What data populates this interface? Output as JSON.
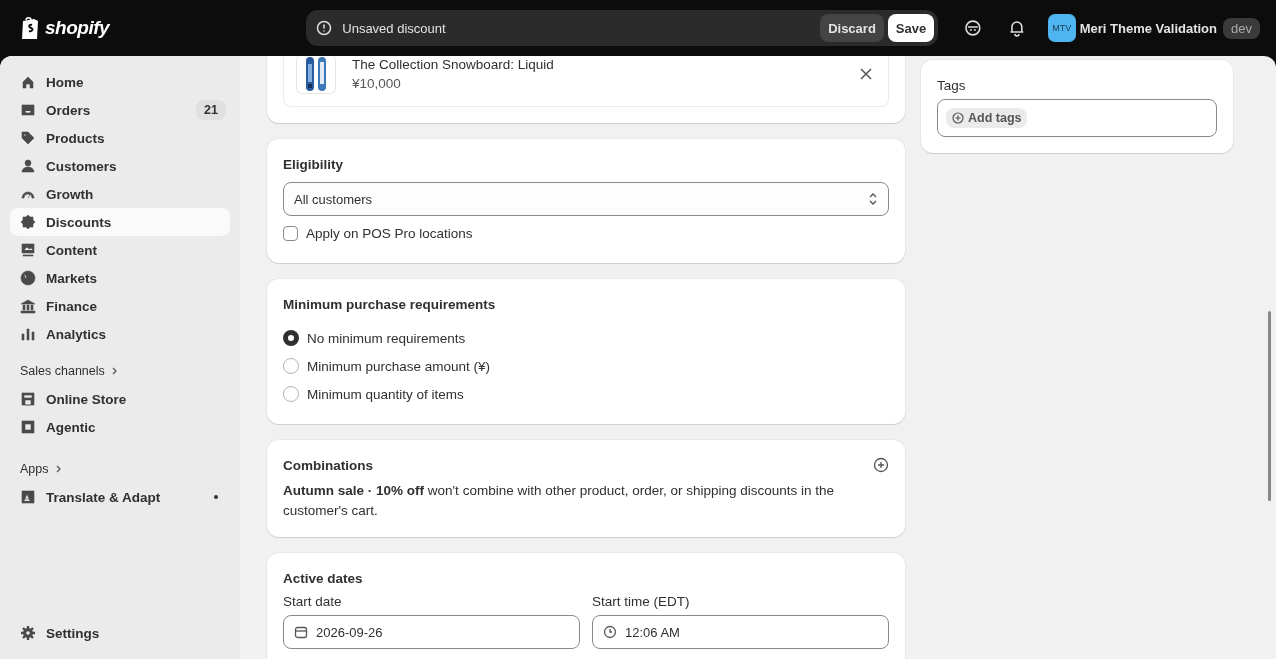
{
  "topbar": {
    "brand": "shopify",
    "notice": "Unsaved discount",
    "buttons": [
      {
        "label": "Discard",
        "kind": "secondary"
      },
      {
        "label": "Save",
        "kind": "primary"
      }
    ],
    "store": {
      "initials": "MTV",
      "name": "Meri Theme Validation",
      "badge": "dev"
    }
  },
  "sidebar": {
    "items": [
      {
        "label": "Home",
        "selected": false
      },
      {
        "label": "Orders",
        "selected": false,
        "count": "21"
      },
      {
        "label": "Products",
        "selected": false
      },
      {
        "label": "Customers",
        "selected": false
      },
      {
        "label": "Growth",
        "selected": false
      },
      {
        "label": "Discounts",
        "selected": true
      },
      {
        "label": "Content",
        "selected": false
      },
      {
        "label": "Markets",
        "selected": false
      },
      {
        "label": "Finance",
        "selected": false
      },
      {
        "label": "Analytics",
        "selected": false
      }
    ],
    "sections": [
      {
        "title": "Sales channels",
        "items": [
          {
            "label": "Online Store",
            "dot": false
          },
          {
            "label": "Agentic",
            "dot": false
          }
        ]
      },
      {
        "title": "Apps",
        "items": [
          {
            "label": "Translate & Adapt",
            "dot": true
          }
        ]
      }
    ],
    "footer": {
      "label": "Settings"
    }
  },
  "product": {
    "name": "The Collection Snowboard: Liquid",
    "price": "¥10,000"
  },
  "eligibility": {
    "title": "Eligibility",
    "select": "All customers",
    "checkbox": {
      "label": "Apply on POS Pro locations",
      "checked": false
    }
  },
  "minimum": {
    "title": "Minimum purchase requirements",
    "options": [
      {
        "label": "No minimum requirements",
        "selected": true
      },
      {
        "label": "Minimum purchase amount (¥)",
        "selected": false
      },
      {
        "label": "Minimum quantity of items",
        "selected": false
      }
    ]
  },
  "combinations": {
    "title": "Combinations",
    "text": "**Autumn sale · 10% off** won't combine with other product, order, or shipping discounts in the customer's cart."
  },
  "active_dates": {
    "title": "Active dates",
    "fields": [
      {
        "label": "Start date",
        "value": "2026-09-26",
        "kind": "date"
      },
      {
        "label": "Start time (EDT)",
        "value": "12:06 AM",
        "kind": "time"
      }
    ]
  },
  "tags": {
    "title": "Tags",
    "button": "Add tags"
  }
}
